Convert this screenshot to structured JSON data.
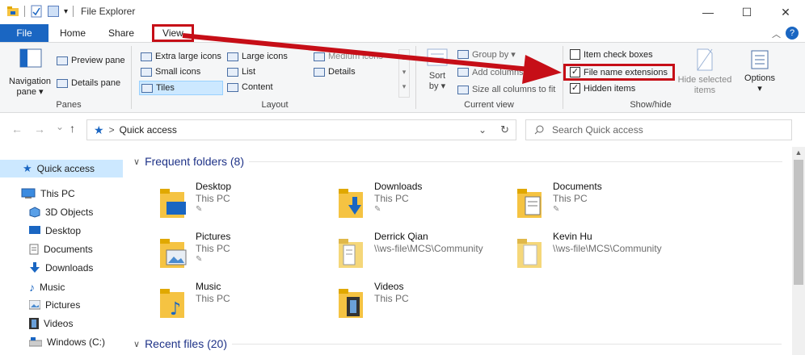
{
  "window": {
    "title": "File Explorer",
    "minimize": "—",
    "maximize": "☐",
    "close": "✕"
  },
  "tabs": {
    "file": "File",
    "home": "Home",
    "share": "Share",
    "view": "View"
  },
  "help": "?",
  "ribbon": {
    "panes": {
      "navigation_pane": "Navigation",
      "navigation_pane2": "pane ▾",
      "preview_pane": "Preview pane",
      "details_pane": "Details pane",
      "label": "Panes"
    },
    "layout": {
      "extra_large_icons": "Extra large icons",
      "large_icons": "Large icons",
      "medium_icons": "Medium icons",
      "small_icons": "Small icons",
      "list": "List",
      "details": "Details",
      "tiles": "Tiles",
      "content": "Content",
      "label": "Layout"
    },
    "current_view": {
      "sort_by": "Sort",
      "sort_by2": "by ▾",
      "group_by": "Group by ▾",
      "add_columns": "Add columns ▾",
      "size_all_columns": "Size all columns to fit",
      "label": "Current view"
    },
    "show_hide": {
      "item_check_boxes": "Item check boxes",
      "file_name_extensions": "File name extensions",
      "hidden_items": "Hidden items",
      "hide_selected": "Hide selected",
      "hide_selected2": "items",
      "options": "Options",
      "options_arrow": "▾",
      "label": "Show/hide",
      "item_check_boxes_checked": false,
      "file_name_extensions_checked": true,
      "hidden_items_checked": true
    }
  },
  "address": {
    "back": "←",
    "forward": "→",
    "recent": "⌄",
    "up": "↑",
    "separator": ">",
    "path": "Quick access",
    "dropdown": "⌄",
    "refresh": "↻",
    "search_placeholder": "Search Quick access"
  },
  "navpane": {
    "quick_access": "Quick access",
    "this_pc": "This PC",
    "objects3d": "3D Objects",
    "desktop": "Desktop",
    "documents": "Documents",
    "downloads": "Downloads",
    "music": "Music",
    "pictures": "Pictures",
    "videos": "Videos",
    "windows_c": "Windows (C:)"
  },
  "content": {
    "frequent_folders": "Frequent folders (8)",
    "recent_files": "Recent files (20)",
    "folders": [
      {
        "name": "Desktop",
        "location": "This PC"
      },
      {
        "name": "Downloads",
        "location": "This PC"
      },
      {
        "name": "Documents",
        "location": "This PC"
      },
      {
        "name": "Pictures",
        "location": "This PC"
      },
      {
        "name": "Derrick Qian",
        "location": "\\\\ws-file\\MCS\\Community"
      },
      {
        "name": "Kevin Hu",
        "location": "\\\\ws-file\\MCS\\Community"
      },
      {
        "name": "Music",
        "location": "This PC"
      },
      {
        "name": "Videos",
        "location": "This PC"
      }
    ]
  },
  "colors": {
    "accent": "#1a66c2",
    "annotation_red": "#c60e17",
    "folder": "#f5c342",
    "selected": "#cce8ff"
  }
}
